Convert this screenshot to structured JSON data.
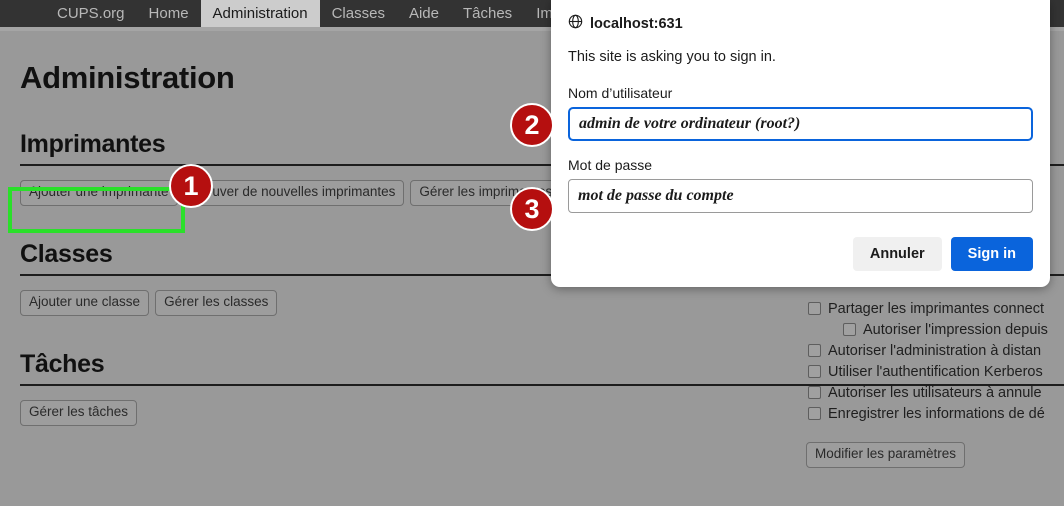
{
  "navbar": {
    "items": [
      {
        "label": "CUPS.org",
        "active": false
      },
      {
        "label": "Home",
        "active": false
      },
      {
        "label": "Administration",
        "active": true
      },
      {
        "label": "Classes",
        "active": false
      },
      {
        "label": "Aide",
        "active": false
      },
      {
        "label": "Tâches",
        "active": false
      },
      {
        "label": "Imp",
        "active": false
      }
    ]
  },
  "page": {
    "title": "Administration",
    "sections": [
      {
        "heading": "Imprimantes",
        "buttons": [
          "Ajouter une imprimante",
          "Trouver de nouvelles imprimantes",
          "Gérer les imprimantes"
        ]
      },
      {
        "heading": "Classes",
        "buttons": [
          "Ajouter une classe",
          "Gérer les classes"
        ]
      },
      {
        "heading": "Tâches",
        "buttons": [
          "Gérer les tâches"
        ]
      }
    ]
  },
  "server_options": {
    "checkboxes": [
      {
        "label": "Partager les imprimantes connect",
        "checked": false,
        "indented": false
      },
      {
        "label": "Autoriser l'impression depuis",
        "checked": false,
        "indented": true
      },
      {
        "label": "Autoriser l'administration à distan",
        "checked": false,
        "indented": false
      },
      {
        "label": "Utiliser l'authentification Kerberos",
        "checked": false,
        "indented": false
      },
      {
        "label": "Autoriser les utilisateurs à annule",
        "checked": false,
        "indented": false
      },
      {
        "label": "Enregistrer les informations de dé",
        "checked": false,
        "indented": false
      }
    ],
    "submit_label": "Modifier les paramètres"
  },
  "dialog": {
    "origin": "localhost:631",
    "origin_icon": "globe-icon",
    "prompt": "This site is asking you to sign in.",
    "username_label": "Nom d’utilisateur",
    "username_value": "",
    "username_placeholder": "admin de votre ordinateur (root?)",
    "password_label": "Mot de passe",
    "password_value": "",
    "password_placeholder": "mot de passe du compte",
    "cancel_label": "Annuler",
    "submit_label": "Sign in"
  },
  "annotations": {
    "badges": [
      "1",
      "2",
      "3"
    ],
    "highlight_color": "#2ae02a",
    "badge_color": "#b50f0f"
  }
}
